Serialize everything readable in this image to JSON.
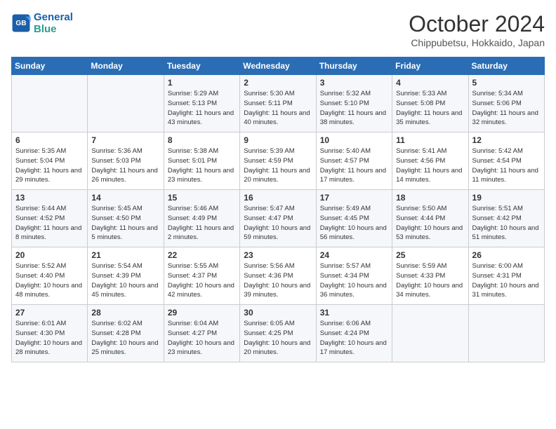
{
  "header": {
    "logo_line1": "General",
    "logo_line2": "Blue",
    "month": "October 2024",
    "location": "Chippubetsu, Hokkaido, Japan"
  },
  "weekdays": [
    "Sunday",
    "Monday",
    "Tuesday",
    "Wednesday",
    "Thursday",
    "Friday",
    "Saturday"
  ],
  "weeks": [
    [
      {
        "day": "",
        "sunrise": "",
        "sunset": "",
        "daylight": ""
      },
      {
        "day": "",
        "sunrise": "",
        "sunset": "",
        "daylight": ""
      },
      {
        "day": "1",
        "sunrise": "Sunrise: 5:29 AM",
        "sunset": "Sunset: 5:13 PM",
        "daylight": "Daylight: 11 hours and 43 minutes."
      },
      {
        "day": "2",
        "sunrise": "Sunrise: 5:30 AM",
        "sunset": "Sunset: 5:11 PM",
        "daylight": "Daylight: 11 hours and 40 minutes."
      },
      {
        "day": "3",
        "sunrise": "Sunrise: 5:32 AM",
        "sunset": "Sunset: 5:10 PM",
        "daylight": "Daylight: 11 hours and 38 minutes."
      },
      {
        "day": "4",
        "sunrise": "Sunrise: 5:33 AM",
        "sunset": "Sunset: 5:08 PM",
        "daylight": "Daylight: 11 hours and 35 minutes."
      },
      {
        "day": "5",
        "sunrise": "Sunrise: 5:34 AM",
        "sunset": "Sunset: 5:06 PM",
        "daylight": "Daylight: 11 hours and 32 minutes."
      }
    ],
    [
      {
        "day": "6",
        "sunrise": "Sunrise: 5:35 AM",
        "sunset": "Sunset: 5:04 PM",
        "daylight": "Daylight: 11 hours and 29 minutes."
      },
      {
        "day": "7",
        "sunrise": "Sunrise: 5:36 AM",
        "sunset": "Sunset: 5:03 PM",
        "daylight": "Daylight: 11 hours and 26 minutes."
      },
      {
        "day": "8",
        "sunrise": "Sunrise: 5:38 AM",
        "sunset": "Sunset: 5:01 PM",
        "daylight": "Daylight: 11 hours and 23 minutes."
      },
      {
        "day": "9",
        "sunrise": "Sunrise: 5:39 AM",
        "sunset": "Sunset: 4:59 PM",
        "daylight": "Daylight: 11 hours and 20 minutes."
      },
      {
        "day": "10",
        "sunrise": "Sunrise: 5:40 AM",
        "sunset": "Sunset: 4:57 PM",
        "daylight": "Daylight: 11 hours and 17 minutes."
      },
      {
        "day": "11",
        "sunrise": "Sunrise: 5:41 AM",
        "sunset": "Sunset: 4:56 PM",
        "daylight": "Daylight: 11 hours and 14 minutes."
      },
      {
        "day": "12",
        "sunrise": "Sunrise: 5:42 AM",
        "sunset": "Sunset: 4:54 PM",
        "daylight": "Daylight: 11 hours and 11 minutes."
      }
    ],
    [
      {
        "day": "13",
        "sunrise": "Sunrise: 5:44 AM",
        "sunset": "Sunset: 4:52 PM",
        "daylight": "Daylight: 11 hours and 8 minutes."
      },
      {
        "day": "14",
        "sunrise": "Sunrise: 5:45 AM",
        "sunset": "Sunset: 4:50 PM",
        "daylight": "Daylight: 11 hours and 5 minutes."
      },
      {
        "day": "15",
        "sunrise": "Sunrise: 5:46 AM",
        "sunset": "Sunset: 4:49 PM",
        "daylight": "Daylight: 11 hours and 2 minutes."
      },
      {
        "day": "16",
        "sunrise": "Sunrise: 5:47 AM",
        "sunset": "Sunset: 4:47 PM",
        "daylight": "Daylight: 10 hours and 59 minutes."
      },
      {
        "day": "17",
        "sunrise": "Sunrise: 5:49 AM",
        "sunset": "Sunset: 4:45 PM",
        "daylight": "Daylight: 10 hours and 56 minutes."
      },
      {
        "day": "18",
        "sunrise": "Sunrise: 5:50 AM",
        "sunset": "Sunset: 4:44 PM",
        "daylight": "Daylight: 10 hours and 53 minutes."
      },
      {
        "day": "19",
        "sunrise": "Sunrise: 5:51 AM",
        "sunset": "Sunset: 4:42 PM",
        "daylight": "Daylight: 10 hours and 51 minutes."
      }
    ],
    [
      {
        "day": "20",
        "sunrise": "Sunrise: 5:52 AM",
        "sunset": "Sunset: 4:40 PM",
        "daylight": "Daylight: 10 hours and 48 minutes."
      },
      {
        "day": "21",
        "sunrise": "Sunrise: 5:54 AM",
        "sunset": "Sunset: 4:39 PM",
        "daylight": "Daylight: 10 hours and 45 minutes."
      },
      {
        "day": "22",
        "sunrise": "Sunrise: 5:55 AM",
        "sunset": "Sunset: 4:37 PM",
        "daylight": "Daylight: 10 hours and 42 minutes."
      },
      {
        "day": "23",
        "sunrise": "Sunrise: 5:56 AM",
        "sunset": "Sunset: 4:36 PM",
        "daylight": "Daylight: 10 hours and 39 minutes."
      },
      {
        "day": "24",
        "sunrise": "Sunrise: 5:57 AM",
        "sunset": "Sunset: 4:34 PM",
        "daylight": "Daylight: 10 hours and 36 minutes."
      },
      {
        "day": "25",
        "sunrise": "Sunrise: 5:59 AM",
        "sunset": "Sunset: 4:33 PM",
        "daylight": "Daylight: 10 hours and 34 minutes."
      },
      {
        "day": "26",
        "sunrise": "Sunrise: 6:00 AM",
        "sunset": "Sunset: 4:31 PM",
        "daylight": "Daylight: 10 hours and 31 minutes."
      }
    ],
    [
      {
        "day": "27",
        "sunrise": "Sunrise: 6:01 AM",
        "sunset": "Sunset: 4:30 PM",
        "daylight": "Daylight: 10 hours and 28 minutes."
      },
      {
        "day": "28",
        "sunrise": "Sunrise: 6:02 AM",
        "sunset": "Sunset: 4:28 PM",
        "daylight": "Daylight: 10 hours and 25 minutes."
      },
      {
        "day": "29",
        "sunrise": "Sunrise: 6:04 AM",
        "sunset": "Sunset: 4:27 PM",
        "daylight": "Daylight: 10 hours and 23 minutes."
      },
      {
        "day": "30",
        "sunrise": "Sunrise: 6:05 AM",
        "sunset": "Sunset: 4:25 PM",
        "daylight": "Daylight: 10 hours and 20 minutes."
      },
      {
        "day": "31",
        "sunrise": "Sunrise: 6:06 AM",
        "sunset": "Sunset: 4:24 PM",
        "daylight": "Daylight: 10 hours and 17 minutes."
      },
      {
        "day": "",
        "sunrise": "",
        "sunset": "",
        "daylight": ""
      },
      {
        "day": "",
        "sunrise": "",
        "sunset": "",
        "daylight": ""
      }
    ]
  ]
}
